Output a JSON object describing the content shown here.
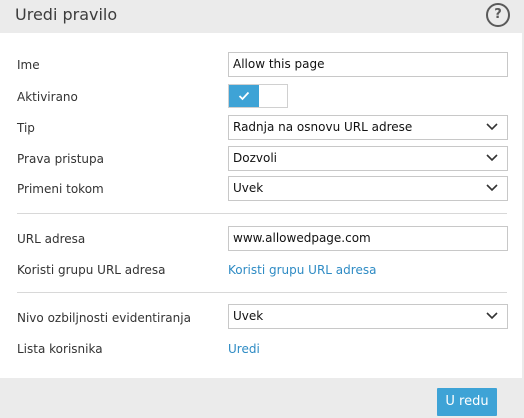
{
  "dialog": {
    "title": "Uredi pravilo",
    "help_icon": "question-mark-icon",
    "help_glyph": "?"
  },
  "form": {
    "name": {
      "label": "Ime",
      "value": "Allow this page"
    },
    "enabled": {
      "label": "Aktivirano",
      "on": true,
      "icon": "check-icon"
    },
    "type": {
      "label": "Tip",
      "value": "Radnja na osnovu URL adrese"
    },
    "access": {
      "label": "Prava pristupa",
      "value": "Dozvoli"
    },
    "apply_during": {
      "label": "Primeni tokom",
      "value": "Uvek"
    },
    "url": {
      "label": "URL adresa",
      "value": "www.allowedpage.com"
    },
    "url_group": {
      "label": "Koristi grupu URL adresa",
      "link": "Koristi grupu URL adresa"
    },
    "log_severity": {
      "label": "Nivo ozbiljnosti evidentiranja",
      "value": "Uvek"
    },
    "user_list": {
      "label": "Lista korisnika",
      "link": "Uredi"
    }
  },
  "footer": {
    "ok_label": "U redu"
  },
  "colors": {
    "accent": "#3ea3d6",
    "link": "#2e8bc4",
    "chrome": "#ebebeb"
  }
}
